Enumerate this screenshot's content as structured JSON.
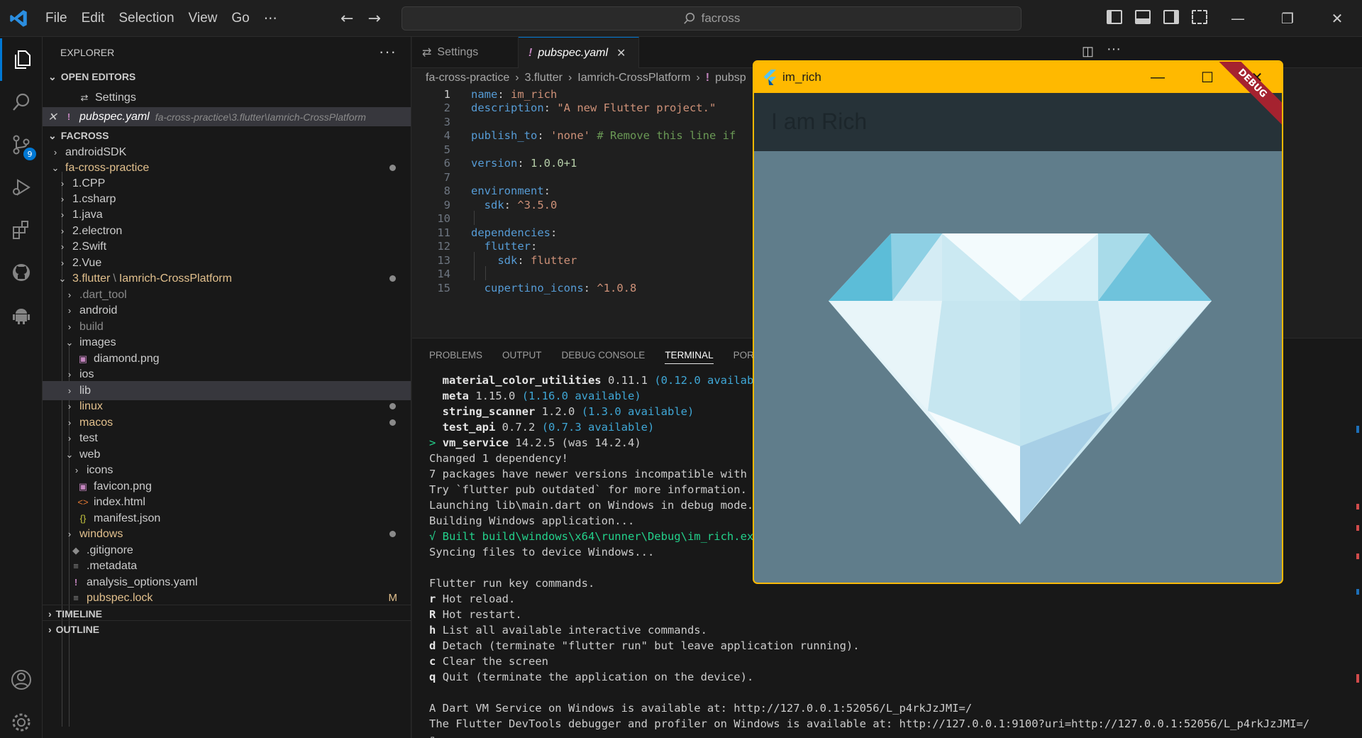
{
  "menu": [
    "File",
    "Edit",
    "Selection",
    "View",
    "Go",
    "⋯"
  ],
  "search": {
    "text": "facross"
  },
  "activity": {
    "scm_badge": "9"
  },
  "explorer": {
    "title": "EXPLORER",
    "open_editors_label": "OPEN EDITORS",
    "open_editors": [
      {
        "name": "Settings",
        "path": ""
      },
      {
        "name": "pubspec.yaml",
        "path": "fa-cross-practice\\3.flutter\\Iamrich-CrossPlatform"
      }
    ],
    "workspace_label": "FACROSS",
    "tree": [
      "androidSDK",
      "fa-cross-practice",
      "1.CPP",
      "1.csharp",
      "1.java",
      "2.electron",
      "2.Swift",
      "2.Vue",
      "3.flutter",
      "Iamrich-CrossPlatform",
      ".dart_tool",
      "android",
      "build",
      "images",
      "diamond.png",
      "ios",
      "lib",
      "linux",
      "macos",
      "test",
      "web",
      "icons",
      "favicon.png",
      "index.html",
      "manifest.json",
      "windows",
      ".gitignore",
      ".metadata",
      "analysis_options.yaml",
      "pubspec.lock"
    ],
    "modified_flag": "M",
    "timeline_label": "TIMELINE",
    "outline_label": "OUTLINE"
  },
  "tabs": [
    {
      "label": "Settings"
    },
    {
      "label": "pubspec.yaml"
    }
  ],
  "breadcrumb": [
    "fa-cross-practice",
    "3.flutter",
    "Iamrich-CrossPlatform",
    "pubsp"
  ],
  "code": {
    "lines": [
      {
        "n": "1",
        "key": "name",
        "val": "im_rich"
      },
      {
        "n": "2",
        "key": "description",
        "val": "\"A new Flutter project.\""
      },
      {
        "n": "3"
      },
      {
        "n": "4",
        "key": "publish_to",
        "val": "'none'",
        "comment": "# Remove this line if"
      },
      {
        "n": "5"
      },
      {
        "n": "6",
        "key": "version",
        "val": "1.0.0+1"
      },
      {
        "n": "7"
      },
      {
        "n": "8",
        "key": "environment",
        "val": ""
      },
      {
        "n": "9",
        "key": "sdk",
        "val": "^3.5.0"
      },
      {
        "n": "10"
      },
      {
        "n": "11",
        "key": "dependencies",
        "val": ""
      },
      {
        "n": "12",
        "key": "flutter",
        "val": ""
      },
      {
        "n": "13",
        "key": "sdk",
        "val": "flutter"
      },
      {
        "n": "14"
      },
      {
        "n": "15",
        "key": "cupertino_icons",
        "val": "^1.0.8"
      }
    ]
  },
  "panel": {
    "tabs": [
      "PROBLEMS",
      "OUTPUT",
      "DEBUG CONSOLE",
      "TERMINAL",
      "PORTS"
    ],
    "terminal": {
      "pkgs": [
        {
          "name": "material_color_utilities",
          "ver": "0.11.1",
          "avail": "(0.12.0 available)"
        },
        {
          "name": "meta",
          "ver": "1.15.0",
          "avail": "(1.16.0 available)"
        },
        {
          "name": "string_scanner",
          "ver": "1.2.0",
          "avail": "(1.3.0 available)"
        },
        {
          "name": "test_api",
          "ver": "0.7.2",
          "avail": "(0.7.3 available)"
        }
      ],
      "vm_service_arrow": ">",
      "vm_service": "vm_service",
      "vm_service_ver": "14.2.5 (was 14.2.4)",
      "l_changed": "Changed 1 dependency!",
      "l_newer": "7 packages have newer versions incompatible with de",
      "l_try": "Try `flutter pub outdated` for more information.",
      "l_launch": "Launching lib\\main.dart on Windows in debug mode...",
      "l_build": "Building Windows application...",
      "l_built": "√ Built build\\windows\\x64\\runner\\Debug\\im_rich.exe",
      "l_sync": "Syncing files to device Windows...",
      "l_keys": "Flutter run key commands.",
      "commands": [
        {
          "key": "r",
          "desc": "Hot reload."
        },
        {
          "key": "R",
          "desc": "Hot restart."
        },
        {
          "key": "h",
          "desc": "List all available interactive commands."
        },
        {
          "key": "d",
          "desc": "Detach (terminate \"flutter run\" but leave application running)."
        },
        {
          "key": "c",
          "desc": "Clear the screen"
        },
        {
          "key": "q",
          "desc": "Quit (terminate the application on the device)."
        }
      ],
      "l_vm": "A Dart VM Service on Windows is available at: http://127.0.0.1:52056/L_p4rkJzJMI=/",
      "l_devtools": "The Flutter DevTools debugger and profiler on Windows is available at: http://127.0.0.1:9100?uri=http://127.0.0.1:52056/L_p4rkJzJMI=/"
    }
  },
  "app_window": {
    "title": "im_rich",
    "appbar_title": "I am Rich",
    "debug_banner": "DEBUG",
    "border_color": "#ffb900",
    "background": "#607d8b",
    "appbar_color": "#263238"
  },
  "colors": {
    "accent": "#0078d4",
    "folder_modified": "#e2c08d"
  }
}
